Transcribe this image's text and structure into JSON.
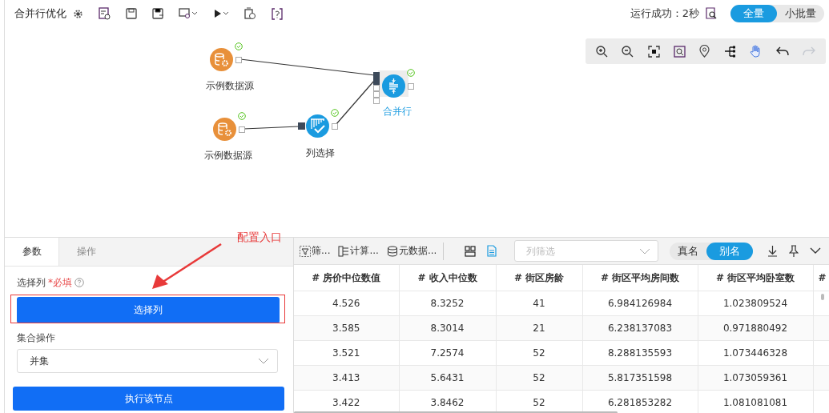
{
  "title": "合并行优化",
  "run_status": "运行成功：2秒",
  "modes": [
    {
      "label": "全量",
      "selected": true
    },
    {
      "label": "小批量",
      "selected": false
    }
  ],
  "nodes": [
    {
      "kind": "source",
      "label": "示例数据源",
      "done": true,
      "selected": false
    },
    {
      "kind": "source",
      "label": "示例数据源",
      "done": true,
      "selected": false
    },
    {
      "kind": "select",
      "label": "列选择",
      "done": true,
      "selected": false
    },
    {
      "kind": "merge",
      "label": "合并行",
      "done": true,
      "selected": true
    }
  ],
  "param_tabs": [
    {
      "label": "参数",
      "selected": true
    },
    {
      "label": "操作",
      "selected": false
    }
  ],
  "field_label": "选择列",
  "required_mark": "*必填",
  "select_button": "选择列",
  "set_op_label": "集合操作",
  "set_op_value": "并集",
  "run_button": "执行该节点",
  "annotation": "配置入口",
  "data_tools": [
    {
      "kind": "filter",
      "label": "筛..."
    },
    {
      "kind": "calc",
      "label": "计算..."
    },
    {
      "kind": "meta",
      "label": "元数据..."
    }
  ],
  "column_filter": {
    "placeholder": "列筛选"
  },
  "name_modes": [
    {
      "label": "真名",
      "selected": false
    },
    {
      "label": "别名",
      "selected": true
    }
  ],
  "table": {
    "columns": [
      "# 房价中位数值",
      "# 收入中位数",
      "# 街区房龄",
      "# 街区平均房间数",
      "# 街区平均卧室数",
      "#"
    ],
    "rows": [
      [
        "4.526",
        "8.3252",
        "41",
        "6.984126984",
        "1.023809524",
        ""
      ],
      [
        "3.585",
        "8.3014",
        "21",
        "6.238137083",
        "0.971880492",
        ""
      ],
      [
        "3.521",
        "7.2574",
        "52",
        "8.288135593",
        "1.073446328",
        ""
      ],
      [
        "3.413",
        "5.6431",
        "52",
        "5.817351598",
        "1.073059361",
        ""
      ],
      [
        "3.422",
        "3.8462",
        "52",
        "6.281853282",
        "1.081081081",
        ""
      ]
    ]
  }
}
